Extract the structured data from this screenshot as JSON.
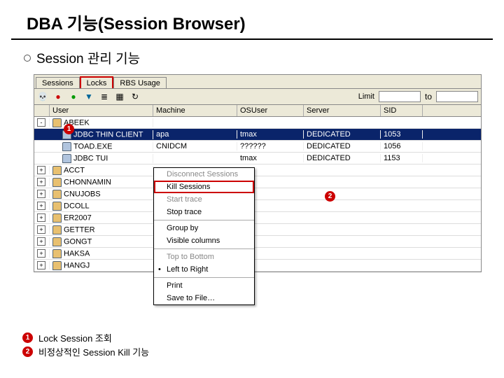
{
  "title": "DBA 기능(Session Browser)",
  "subtitle": "Session 관리 기능",
  "tabs": {
    "sessions": "Sessions",
    "locks": "Locks",
    "rbs": "RBS Usage"
  },
  "toolbar": {
    "limit_label": "Limit",
    "to_label": "to",
    "limit_from": "",
    "limit_to": ""
  },
  "headers": {
    "user": "User",
    "machine": "Machine",
    "osuser": "OSUser",
    "server": "Server",
    "sid": "SID"
  },
  "rows": [
    {
      "tree": "-",
      "user": "ABEEK",
      "machine": "",
      "osuser": "",
      "server": "",
      "sid": "",
      "child": false,
      "sel": false
    },
    {
      "tree": "",
      "user": "JDBC THIN CLIENT",
      "machine": "apa",
      "osuser": "tmax",
      "server": "DEDICATED",
      "sid": "1053",
      "child": true,
      "sel": true
    },
    {
      "tree": "",
      "user": "TOAD.EXE",
      "machine": "CNIDCM",
      "osuser": "??????",
      "server": "DEDICATED",
      "sid": "1056",
      "child": true,
      "sel": false
    },
    {
      "tree": "",
      "user": "JDBC TUI",
      "machine": "",
      "osuser": "tmax",
      "server": "DEDICATED",
      "sid": "1153",
      "child": true,
      "sel": false
    },
    {
      "tree": "+",
      "user": "ACCT",
      "machine": "",
      "osuser": "",
      "server": "",
      "sid": "",
      "child": false,
      "sel": false
    },
    {
      "tree": "+",
      "user": "CHONNAMIN",
      "machine": "",
      "osuser": "",
      "server": "",
      "sid": "",
      "child": false,
      "sel": false
    },
    {
      "tree": "+",
      "user": "CNUJOBS",
      "machine": "",
      "osuser": "",
      "server": "",
      "sid": "",
      "child": false,
      "sel": false
    },
    {
      "tree": "+",
      "user": "DCOLL",
      "machine": "",
      "osuser": "",
      "server": "",
      "sid": "",
      "child": false,
      "sel": false
    },
    {
      "tree": "+",
      "user": "ER2007",
      "machine": "",
      "osuser": "",
      "server": "",
      "sid": "",
      "child": false,
      "sel": false
    },
    {
      "tree": "+",
      "user": "GETTER",
      "machine": "",
      "osuser": "",
      "server": "",
      "sid": "",
      "child": false,
      "sel": false
    },
    {
      "tree": "+",
      "user": "GONGT",
      "machine": "",
      "osuser": "",
      "server": "",
      "sid": "",
      "child": false,
      "sel": false
    },
    {
      "tree": "+",
      "user": "HAKSA",
      "machine": "",
      "osuser": "",
      "server": "",
      "sid": "",
      "child": false,
      "sel": false
    },
    {
      "tree": "+",
      "user": "HANGJ",
      "machine": "",
      "osuser": "",
      "server": "",
      "sid": "",
      "child": false,
      "sel": false
    }
  ],
  "menu": {
    "disconnect": "Disconnect Sessions",
    "kill": "Kill Sessions",
    "start_trace": "Start trace",
    "stop_trace": "Stop trace",
    "group_by": "Group by",
    "visible_cols": "Visible columns",
    "ttb": "Top to Bottom",
    "ltr": "Left to Right",
    "print": "Print",
    "save": "Save to File…"
  },
  "callouts": {
    "one": "1",
    "two": "2"
  },
  "legend": {
    "l1": "Lock Session 조회",
    "l2": "비정상적인 Session Kill 기능"
  }
}
